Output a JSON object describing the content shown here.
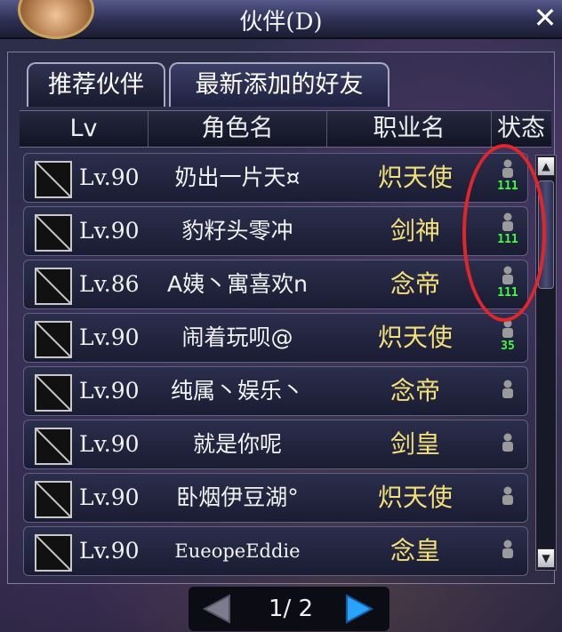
{
  "window": {
    "title": "伙伴(D)",
    "close_label": "✕"
  },
  "tabs": [
    {
      "label": "推荐伙伴",
      "active": false
    },
    {
      "label": "最新添加的好友",
      "active": true
    }
  ],
  "columns": {
    "lv": "Lv",
    "name": "角色名",
    "job": "职业名",
    "status": "状态"
  },
  "rows": [
    {
      "lv": "Lv.90",
      "name": "奶出一片天¤",
      "job": "炽天使",
      "online": "111"
    },
    {
      "lv": "Lv.90",
      "name": "豹籽头零冲",
      "job": "剑神",
      "online": "111"
    },
    {
      "lv": "Lv.86",
      "name": "A姨丶寓喜欢n",
      "job": "念帝",
      "online": "111"
    },
    {
      "lv": "Lv.90",
      "name": "闹着玩呗@",
      "job": "炽天使",
      "online": "35"
    },
    {
      "lv": "Lv.90",
      "name": "纯属丶娱乐丶",
      "job": "念帝",
      "online": ""
    },
    {
      "lv": "Lv.90",
      "name": "就是你呢",
      "job": "剑皇",
      "online": ""
    },
    {
      "lv": "Lv.90",
      "name": "卧烟伊豆湖°",
      "job": "炽天使",
      "online": ""
    },
    {
      "lv": "Lv.90",
      "name": "EueopeEddie",
      "job": "念皇",
      "online": ""
    }
  ],
  "pagination": {
    "page": "1/ 2"
  },
  "colors": {
    "job_text": "#f3e079",
    "online_number": "#3dff3d",
    "highlight_circle": "#e0262b",
    "next_arrow": "#2aa3ff",
    "prev_arrow": "#7c7c8c"
  }
}
